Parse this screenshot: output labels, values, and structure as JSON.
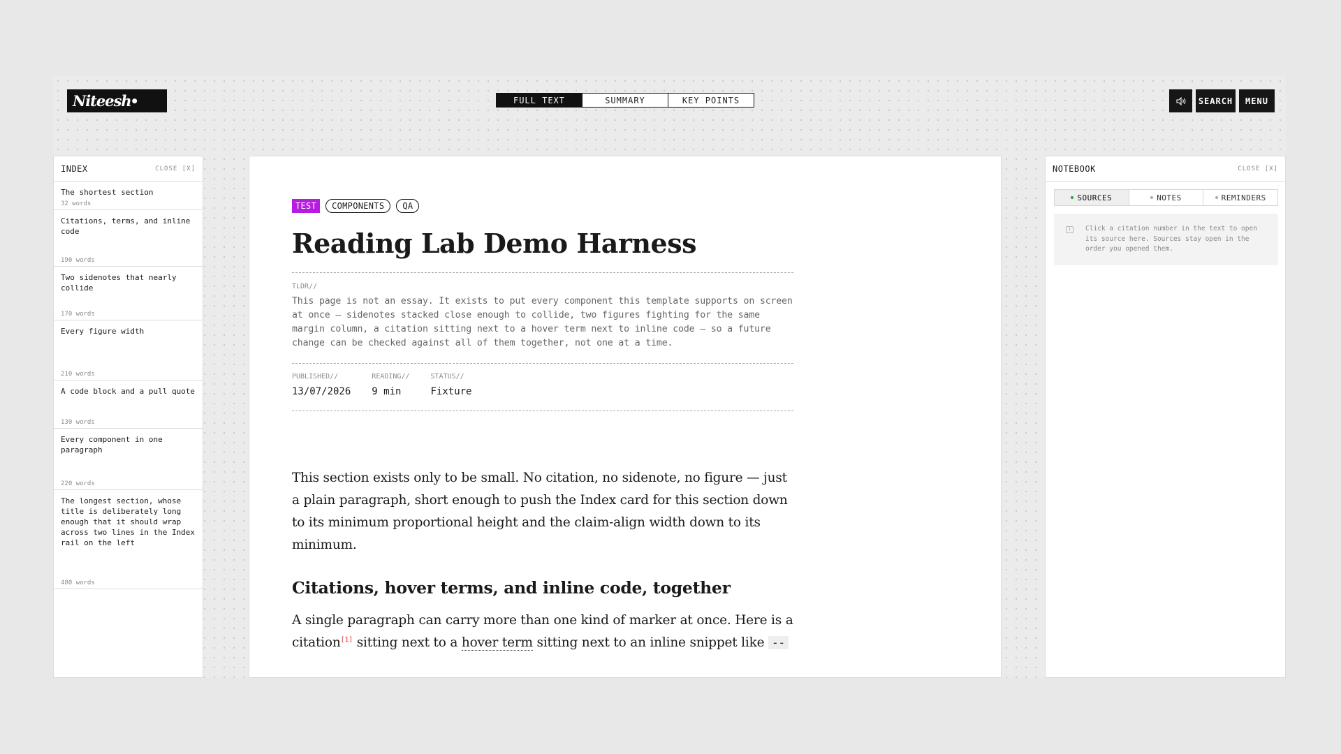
{
  "header": {
    "logo_text": "Niteesh",
    "view_modes": [
      {
        "label": "FULL TEXT",
        "active": true
      },
      {
        "label": "SUMMARY",
        "active": false
      },
      {
        "label": "KEY POINTS",
        "active": false
      }
    ],
    "search_label": "SEARCH",
    "menu_label": "MENU",
    "audio_icon": "speaker-icon"
  },
  "index": {
    "title": "INDEX",
    "close_label": "CLOSE [X]",
    "items": [
      {
        "title": "The shortest section",
        "words": "32 words"
      },
      {
        "title": "Citations, terms, and inline code",
        "words": "190 words"
      },
      {
        "title": "Two sidenotes that nearly collide",
        "words": "170 words"
      },
      {
        "title": "Every figure width",
        "words": "210 words"
      },
      {
        "title": "A code block and a pull quote",
        "words": "130 words"
      },
      {
        "title": "Every component in one paragraph",
        "words": "220 words"
      },
      {
        "title": "The longest section, whose title is deliberately long enough that it should wrap across two lines in the Index rail on the left",
        "words": "480 words"
      }
    ]
  },
  "article": {
    "tags": [
      "TEST",
      "COMPONENTS",
      "QA"
    ],
    "title": "Reading Lab Demo Harness",
    "tldr_label": "TLDR//",
    "tldr": "This page is not an essay. It exists to put every component this template supports on screen at once — sidenotes stacked close enough to collide, two figures fighting for the same margin column, a citation sitting next to a hover term next to inline code — so a future change can be checked against all of them together, not one at a time.",
    "meta": [
      {
        "label": "PUBLISHED//",
        "value": "13/07/2026"
      },
      {
        "label": "READING//",
        "value": "9 min"
      },
      {
        "label": "STATUS//",
        "value": "Fixture"
      }
    ],
    "para1": "This section exists only to be small. No citation, no sidenote, no figure — just a plain paragraph, short enough to push the Index card for this section down to its minimum proportional height and the claim-align width down to its minimum.",
    "heading2": "Citations, hover terms, and inline code, together",
    "para2_a": "A single paragraph can carry more than one kind of marker at once. Here is a citation",
    "para2_cite": "[1]",
    "para2_b": " sitting next to a ",
    "para2_term": "hover term",
    "para2_c": " sitting next to an inline snippet like ",
    "para2_code": "--"
  },
  "notebook": {
    "title": "NOTEBOOK",
    "close_label": "CLOSE [X]",
    "tabs": [
      {
        "label": "SOURCES",
        "active": true
      },
      {
        "label": "NOTES",
        "active": false
      },
      {
        "label": "REMINDERS",
        "active": false
      }
    ],
    "hint": "Click a citation number in the text to open its source here. Sources stay open in the order you opened them."
  }
}
